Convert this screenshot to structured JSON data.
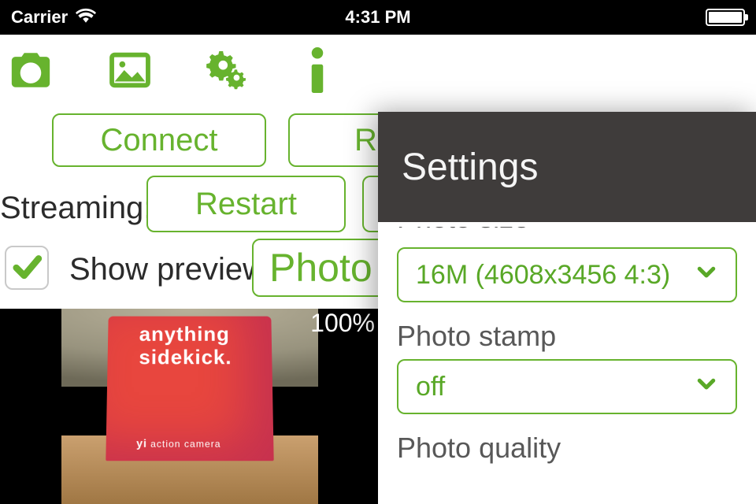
{
  "statusbar": {
    "carrier": "Carrier",
    "time": "4:31 PM"
  },
  "toolbar": {
    "icons": {
      "camera": "camera-icon",
      "gallery": "image-icon",
      "settings": "gears-icon",
      "info": "info-icon"
    }
  },
  "buttons": {
    "connect": "Connect",
    "re_partial": "Re",
    "restart": "Restart",
    "photo": "Photo"
  },
  "labels": {
    "streaming": "Streaming:",
    "show_preview": "Show preview"
  },
  "checkbox": {
    "show_preview_checked": true
  },
  "preview": {
    "percent": "100%",
    "box_line1": "anything",
    "box_line2": "sidekick.",
    "box_brand_logo": "yi",
    "box_brand_text": "action camera"
  },
  "drawer": {
    "title": "Settings",
    "items": [
      {
        "label_cutoff": "Photo size",
        "value": "16M (4608x3456 4:3)"
      },
      {
        "label": "Photo stamp",
        "value": "off"
      },
      {
        "label": "Photo quality"
      }
    ]
  },
  "colors": {
    "accent": "#67b32e"
  }
}
